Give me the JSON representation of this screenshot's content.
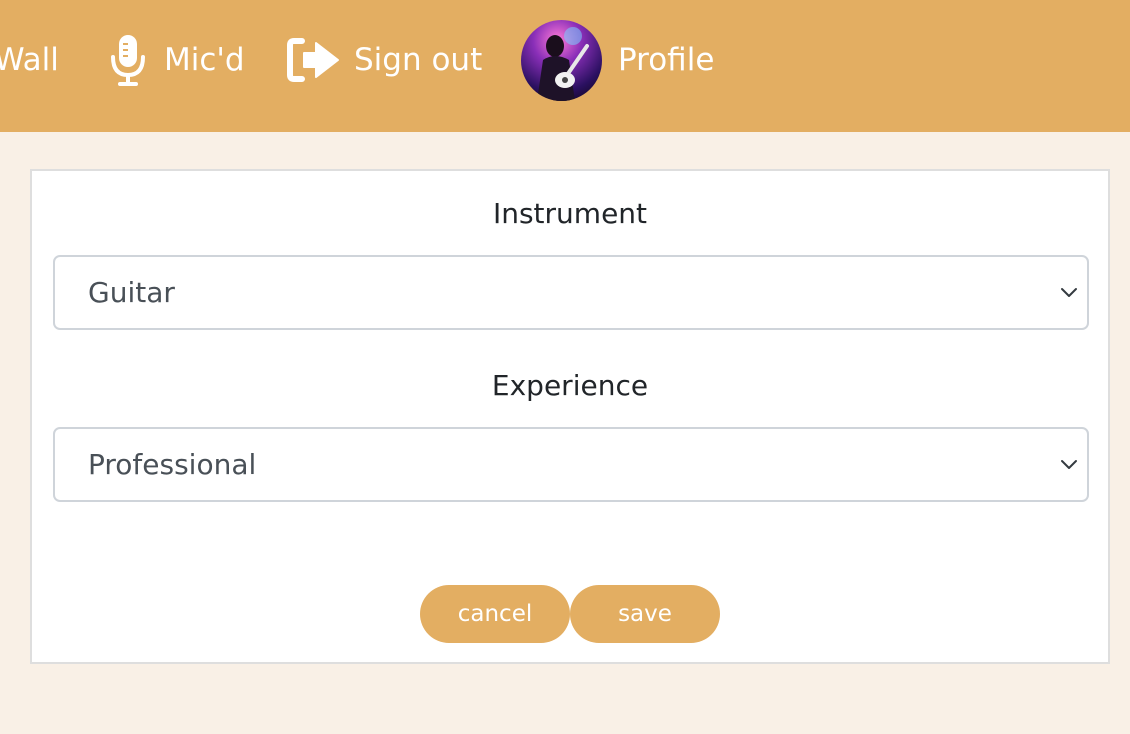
{
  "nav": {
    "wall_label": "Wall",
    "mic_label": "Mic'd",
    "signout_label": "Sign out",
    "profile_label": "Profile",
    "icons": {
      "mic": "microphone-icon",
      "signout": "sign-out-icon",
      "avatar": "profile-avatar"
    }
  },
  "form": {
    "instrument_label": "Instrument",
    "instrument_value": "Guitar",
    "experience_label": "Experience",
    "experience_value": "Professional",
    "cancel_label": "cancel",
    "save_label": "save"
  },
  "colors": {
    "accent": "#e3ae62",
    "background": "#f9f0e6",
    "card": "#ffffff"
  }
}
